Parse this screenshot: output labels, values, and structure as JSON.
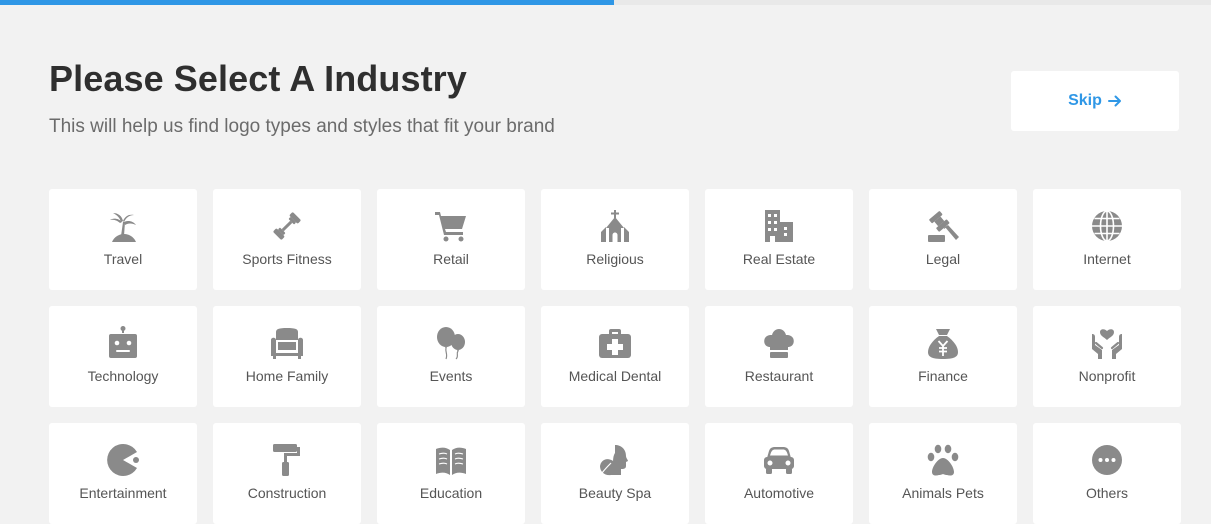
{
  "progress": {
    "fraction": 0.507
  },
  "header": {
    "title": "Please Select A Industry",
    "subtitle": "This will help us find logo types and styles that fit your brand"
  },
  "skip": {
    "label": "Skip",
    "icon": "arrow-right-icon",
    "color": "#2f97e6"
  },
  "icon_color": "#8a8a8a",
  "industries": [
    {
      "label": "Travel",
      "icon": "palm-island-icon"
    },
    {
      "label": "Sports Fitness",
      "icon": "dumbbell-icon"
    },
    {
      "label": "Retail",
      "icon": "shopping-cart-icon"
    },
    {
      "label": "Religious",
      "icon": "church-icon"
    },
    {
      "label": "Real Estate",
      "icon": "building-icon"
    },
    {
      "label": "Legal",
      "icon": "gavel-icon"
    },
    {
      "label": "Internet",
      "icon": "globe-icon"
    },
    {
      "label": "Technology",
      "icon": "robot-icon"
    },
    {
      "label": "Home Family",
      "icon": "armchair-icon"
    },
    {
      "label": "Events",
      "icon": "balloons-icon"
    },
    {
      "label": "Medical Dental",
      "icon": "medical-kit-icon"
    },
    {
      "label": "Restaurant",
      "icon": "chef-hat-icon"
    },
    {
      "label": "Finance",
      "icon": "money-bag-icon"
    },
    {
      "label": "Nonprofit",
      "icon": "hands-heart-icon"
    },
    {
      "label": "Entertainment",
      "icon": "pacman-icon"
    },
    {
      "label": "Construction",
      "icon": "paint-roller-icon"
    },
    {
      "label": "Education",
      "icon": "open-book-icon"
    },
    {
      "label": "Beauty Spa",
      "icon": "face-leaf-icon"
    },
    {
      "label": "Automotive",
      "icon": "car-icon"
    },
    {
      "label": "Animals Pets",
      "icon": "paw-icon"
    },
    {
      "label": "Others",
      "icon": "more-dots-icon"
    }
  ]
}
